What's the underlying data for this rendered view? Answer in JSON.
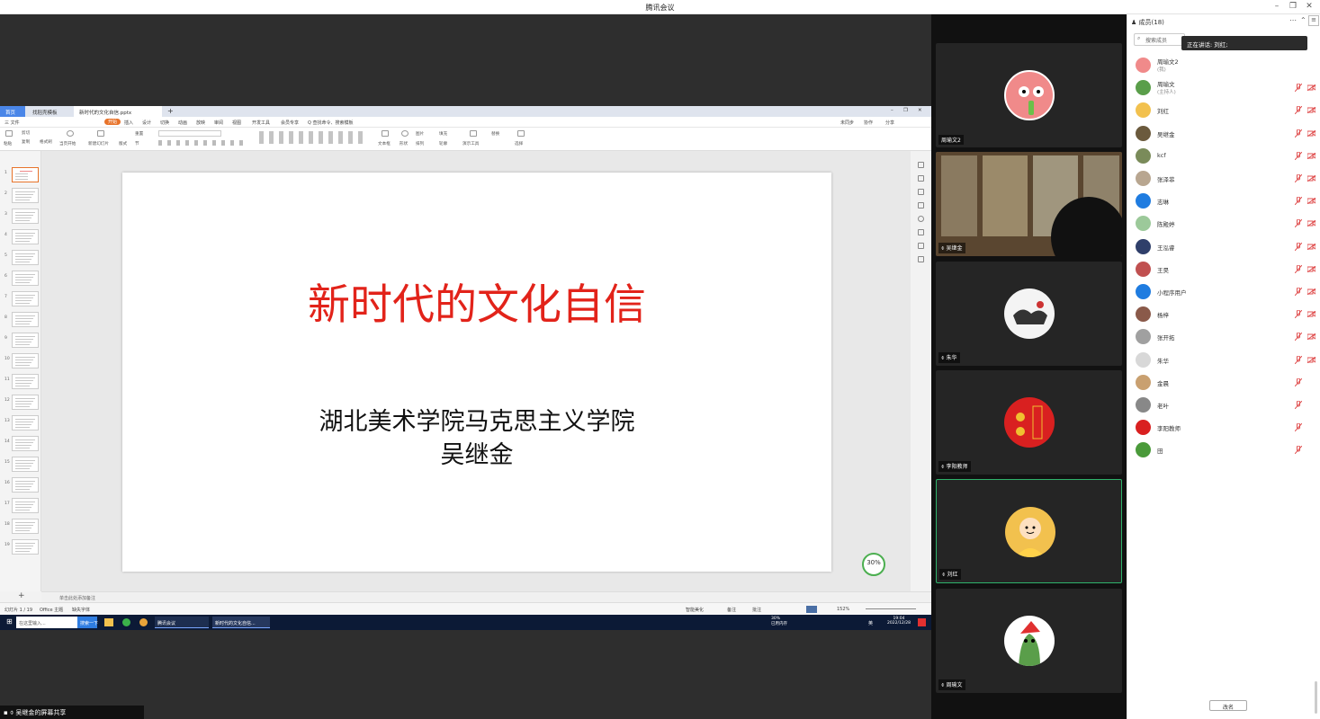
{
  "app": {
    "title": "腾讯会议"
  },
  "screen_share": {
    "label": "吴继金的屏幕共享",
    "wps": {
      "tabs": [
        "首页",
        "找稻壳模板",
        "新时代的文化自信.pptx"
      ],
      "menu": [
        "三 文件",
        "开始",
        "插入",
        "设计",
        "切换",
        "动画",
        "放映",
        "审阅",
        "视图",
        "开发工具",
        "会员专享",
        "Q 查找命令、搜索模板"
      ],
      "menu_right": [
        "未同步",
        "协作",
        "分享"
      ],
      "ribbon": [
        "粘贴",
        "剪切",
        "复制",
        "格式刷",
        "当页开始",
        "新建幻灯片",
        "版式",
        "节",
        "重置",
        "文本框",
        "形状",
        "排列",
        "图片",
        "填充",
        "轮廓",
        "演示工具",
        "替换",
        "选择"
      ],
      "slide": {
        "title": "新时代的文化自信",
        "subtitle1": "湖北美术学院马克思主义学院",
        "subtitle2": "吴继金"
      },
      "slide_numbers": [
        "1",
        "2",
        "3",
        "4",
        "5",
        "6",
        "7",
        "8",
        "9",
        "10",
        "11",
        "12",
        "13",
        "14",
        "15",
        "16",
        "17",
        "18",
        "19"
      ],
      "notes_placeholder": "单击此处添加备注",
      "status": {
        "slide_pos": "幻灯片 1 / 19",
        "theme": "Office 主题",
        "font_missing": "缺失字体",
        "smart": "智能美化",
        "notes": "备注",
        "comments": "批注",
        "zoom": "152%"
      },
      "zoom_badge": "30%"
    },
    "taskbar": {
      "search": "在这里输入...",
      "search_btn": "搜索一下",
      "apps": [
        "腾讯会议",
        "新时代的文化自信..."
      ],
      "time": "19:04",
      "date": "2022/12/28",
      "mem": "30%",
      "mem_label": "已用内存",
      "lang": "英"
    }
  },
  "videos": [
    {
      "name": "周瑜文2"
    },
    {
      "name": "吴继金"
    },
    {
      "name": "朱华"
    },
    {
      "name": "李阳教师"
    },
    {
      "name": "刘红"
    },
    {
      "name": "周瑜文"
    }
  ],
  "members": {
    "header": "成员(18)",
    "search_placeholder": "搜索成员",
    "speaking": "正在讲话: 刘红;",
    "list": [
      {
        "name": "周瑜文2",
        "role": "(我)",
        "color": "#f08a8a"
      },
      {
        "name": "周瑜文",
        "role": "(主持人)",
        "color": "#5a9e4a"
      },
      {
        "name": "刘红",
        "role": "",
        "color": "#f2c14e"
      },
      {
        "name": "吴继金",
        "role": "",
        "color": "#6b5a3d"
      },
      {
        "name": "kcf",
        "role": "",
        "color": "#7a8b5a"
      },
      {
        "name": "张泽菲",
        "role": "",
        "color": "#b8a690"
      },
      {
        "name": "志琳",
        "role": "",
        "color": "#1f7ce0"
      },
      {
        "name": "陈殿婷",
        "role": "",
        "color": "#9cc99a"
      },
      {
        "name": "王泓睿",
        "role": "",
        "color": "#2f3f6a"
      },
      {
        "name": "王昊",
        "role": "",
        "color": "#c05050"
      },
      {
        "name": "小程序用户",
        "role": "",
        "color": "#1f7ce0"
      },
      {
        "name": "杨梓",
        "role": "",
        "color": "#8a5a4a"
      },
      {
        "name": "张开拓",
        "role": "",
        "color": "#a0a0a0"
      },
      {
        "name": "朱华",
        "role": "",
        "color": "#d8d8d8"
      },
      {
        "name": "金晨",
        "role": "",
        "color": "#c9a070"
      },
      {
        "name": "老叶",
        "role": "",
        "color": "#888888"
      },
      {
        "name": "李阳教师",
        "role": "",
        "color": "#d92020"
      },
      {
        "name": "田",
        "role": "",
        "color": "#4a9a3a"
      }
    ],
    "rename_button": "改名"
  }
}
